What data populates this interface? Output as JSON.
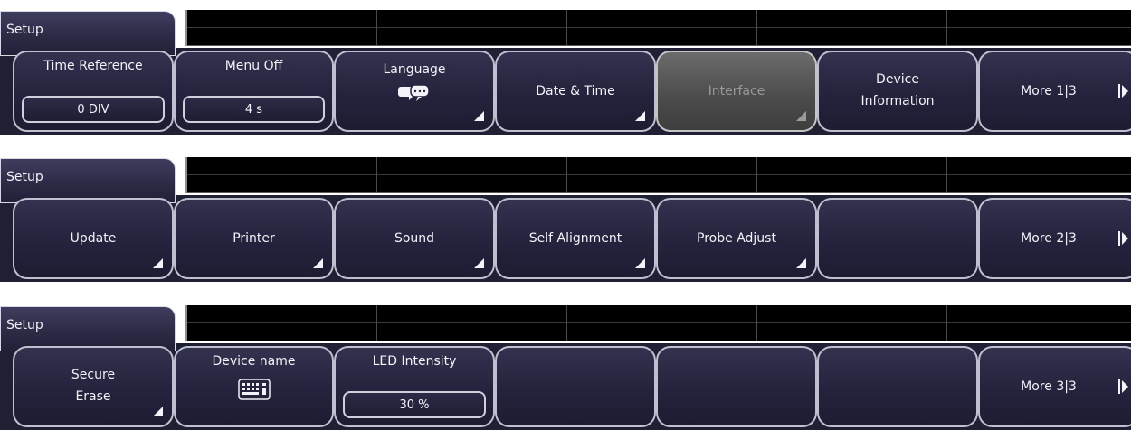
{
  "menus": [
    {
      "tab": "Setup",
      "buttons": {
        "time_reference": {
          "label": "Time Reference",
          "value": "0 DIV"
        },
        "menu_off": {
          "label": "Menu Off",
          "value": "4 s"
        },
        "language": {
          "label": "Language",
          "icon": "speech-bubbles-icon"
        },
        "date_time": {
          "label": "Date & Time"
        },
        "interface": {
          "label": "Interface"
        },
        "device_information": {
          "line1": "Device",
          "line2": "Information"
        },
        "more": {
          "label": "More 1|3"
        }
      }
    },
    {
      "tab": "Setup",
      "buttons": {
        "update": {
          "label": "Update"
        },
        "printer": {
          "label": "Printer"
        },
        "sound": {
          "label": "Sound"
        },
        "self_alignment": {
          "label": "Self Alignment"
        },
        "probe_adjust": {
          "label": "Probe Adjust"
        },
        "more": {
          "label": "More 2|3"
        }
      }
    },
    {
      "tab": "Setup",
      "buttons": {
        "secure_erase": {
          "line1": "Secure",
          "line2": "Erase"
        },
        "device_name": {
          "label": "Device name",
          "icon": "keyboard-icon"
        },
        "led_intensity": {
          "label": "LED Intensity",
          "value": "30 %"
        },
        "more": {
          "label": "More 3|3"
        }
      }
    }
  ],
  "colors": {
    "panel": "#202035",
    "button_border": "#bfc0cf",
    "disabled": "#5a5a5a",
    "screen": "#000000"
  }
}
